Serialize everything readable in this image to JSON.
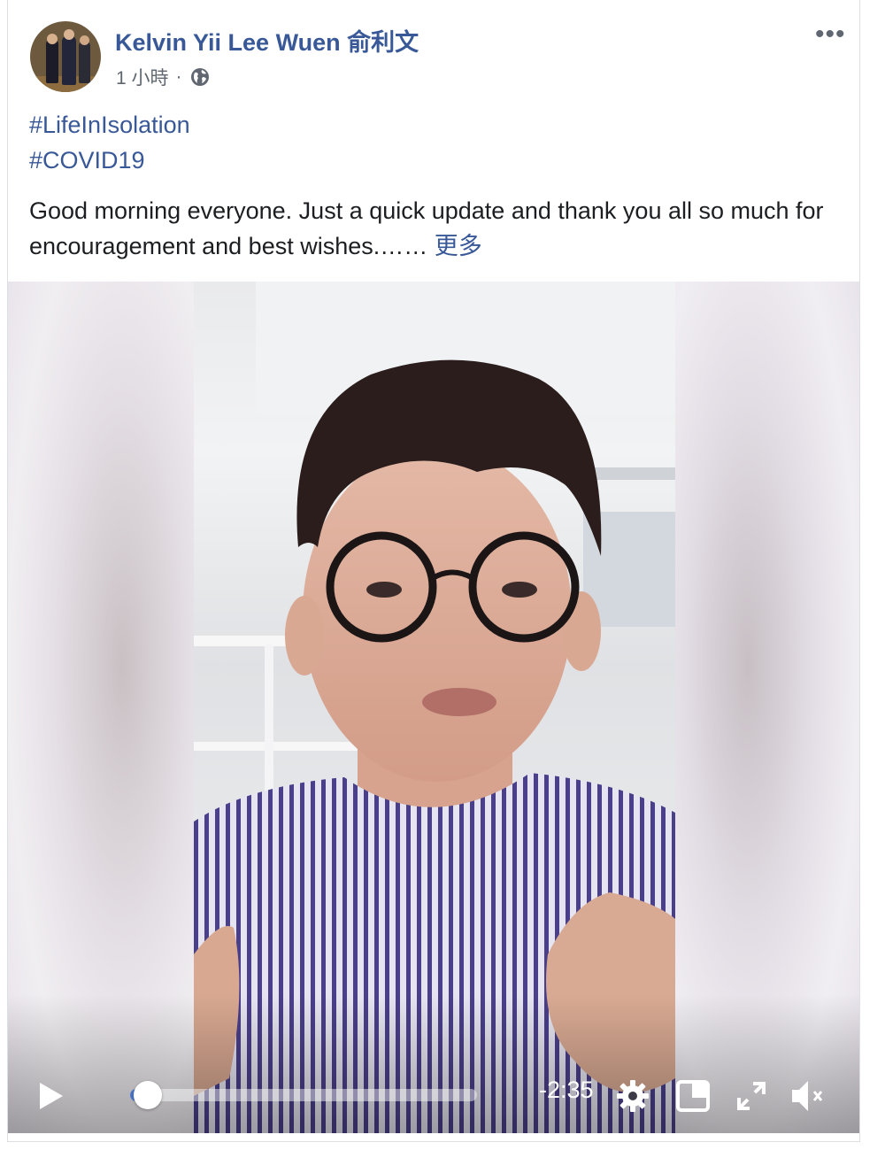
{
  "post": {
    "author": "Kelvin Yii Lee Wuen 俞利文",
    "time": "1 小時",
    "separator": "·",
    "more_menu": "•••",
    "hashtags": [
      "#LifeInIsolation",
      "#COVID19"
    ],
    "text": "Good morning everyone. Just a quick update and thank you all so much for encouragement and best wishes.",
    "ellipsis": "……",
    "see_more": "更多"
  },
  "video": {
    "time_remaining": "-2:35",
    "progress": 0.05,
    "muted": true
  }
}
